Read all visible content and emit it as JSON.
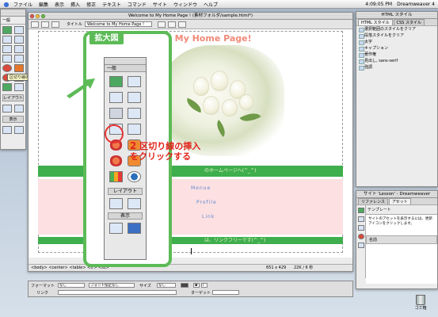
{
  "menubar": {
    "items": [
      "ファイル",
      "編集",
      "表示",
      "挿入",
      "修正",
      "テキスト",
      "コマンド",
      "サイト",
      "ウィンドウ",
      "ヘルプ"
    ],
    "clock": "4:09:05 PM",
    "app_name": "Dreamweaver 4"
  },
  "leftbar": {
    "category": "一般",
    "layout_label": "レイアウト",
    "view_label": "表示",
    "tooltip": "区切り線の挿入"
  },
  "document": {
    "window_title": "Welcome to My Home Page ! (素材フォルダ/sample.html*)",
    "title_label": "タイトル",
    "title_value": "Welcome to My Home Page !",
    "heading": "to My Home Page!",
    "greenbar_text": "のホームページへ(^_^)",
    "menu_items": [
      "Menue",
      "Profile",
      "Link"
    ],
    "footer_text": "は、リンクフリーです(^_^)",
    "status_path": "<body> <center> <table> <tr> <td>",
    "status_size": "651 x 429",
    "status_kb": "22K / 6 秒"
  },
  "properties": {
    "format_label": "フォーマット",
    "format_value": "なし",
    "font_value": "フォント指定なし",
    "size_label": "サイズ",
    "size_value": "なし",
    "link_label": "リンク",
    "target_label": "ターゲット"
  },
  "panel_css": {
    "title": "HTML スタイル",
    "tabs": [
      "HTML スタイル",
      "CSS スタイル"
    ],
    "items": [
      "選択範囲のスタイルをクリア",
      "段落スタイルをクリア",
      "太字",
      "キャプション",
      "著作権",
      "見出し, sans-serif",
      "強調"
    ]
  },
  "panel_site": {
    "title": "サイト 'Lesson' - Dreamweaver",
    "tabs": [
      "リファレンス",
      "アセット"
    ],
    "template_label": "テンプレート",
    "help_text": "サイトのアセットを表示するには、更新アイコンをクリックします。",
    "name_header": "名前"
  },
  "callout": {
    "title": "拡大図",
    "panel_category": "一般",
    "layout_label": "レイアウト",
    "view_label": "表示",
    "annotation_num": "2",
    "annotation_line1": "区切り線の挿入",
    "annotation_line2": "をクリックする"
  },
  "trash": {
    "label": "ゴミ箱"
  },
  "colors": {
    "accent_green": "#5dbb57",
    "annotation_red": "#e2231a",
    "table_green": "#3fae4d",
    "pink": "#fde0e2"
  }
}
